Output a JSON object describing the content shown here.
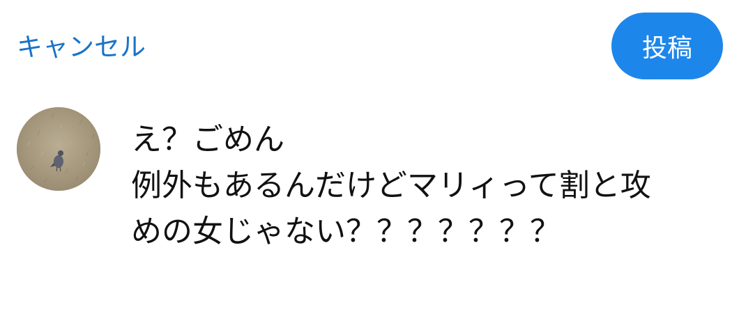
{
  "header": {
    "cancel_label": "キャンセル",
    "post_label": "投稿",
    "accent_color": "#1d86ea"
  },
  "composer": {
    "avatar_icon": "bird-photo-avatar",
    "lines": [
      "え？ごめん",
      "例外もあるんだけどマリィって割と攻",
      "めの女じゃない？？？？？？？"
    ]
  }
}
